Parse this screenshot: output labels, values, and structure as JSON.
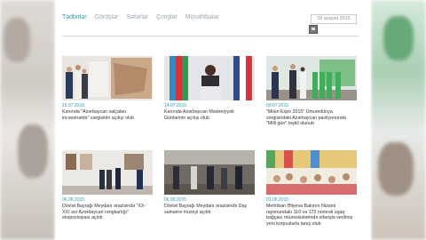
{
  "tabs": [
    {
      "label": "Tədbirlər",
      "active": true
    },
    {
      "label": "Görüşlər",
      "active": false
    },
    {
      "label": "Səfərlər",
      "active": false
    },
    {
      "label": "Çıxışlar",
      "active": false
    },
    {
      "label": "Müsahibələr",
      "active": false
    }
  ],
  "date_filter": {
    "value": "28 avqust 2015"
  },
  "news": [
    {
      "date": "15.07.2015",
      "title": "Kanında \"Azərbaycan xalçaları incəsənətdə\" sərgisinin açılışı olub"
    },
    {
      "date": "14.07.2015",
      "title": "Kanında Azərbaycan Mədəniyyəti Günlərinin açılışı olub"
    },
    {
      "date": "09.07.2015",
      "title": "\"Milan Expo 2015\" Ümumdünya sərgisindəki Azərbaycan pavilyonunda \"Milli gün\" təşkil olunub"
    },
    {
      "date": "06.06.2015",
      "title": "Dövlət Bayrağı Meydanı ərazisində \"XX-XXI əsr Azərbaycan rəngkarlığı\" ekspozisiyası açılıb"
    },
    {
      "date": "06.06.2015",
      "title": "Dövlət Bayrağı Meydanı ərazisində Daş salnamə muzeyi açılıb"
    },
    {
      "date": "01.06.2015",
      "title": "Mehriban Əliyeva Bakının Nizami rayonundakı 110 və 172 nömrəli uşaq bağçası müəssisələrində sifarişlə verilmiş yeni korpuslarla tanış olub"
    }
  ],
  "colors": {
    "accent": "#3a9aa8",
    "date": "#2d9ab0"
  }
}
